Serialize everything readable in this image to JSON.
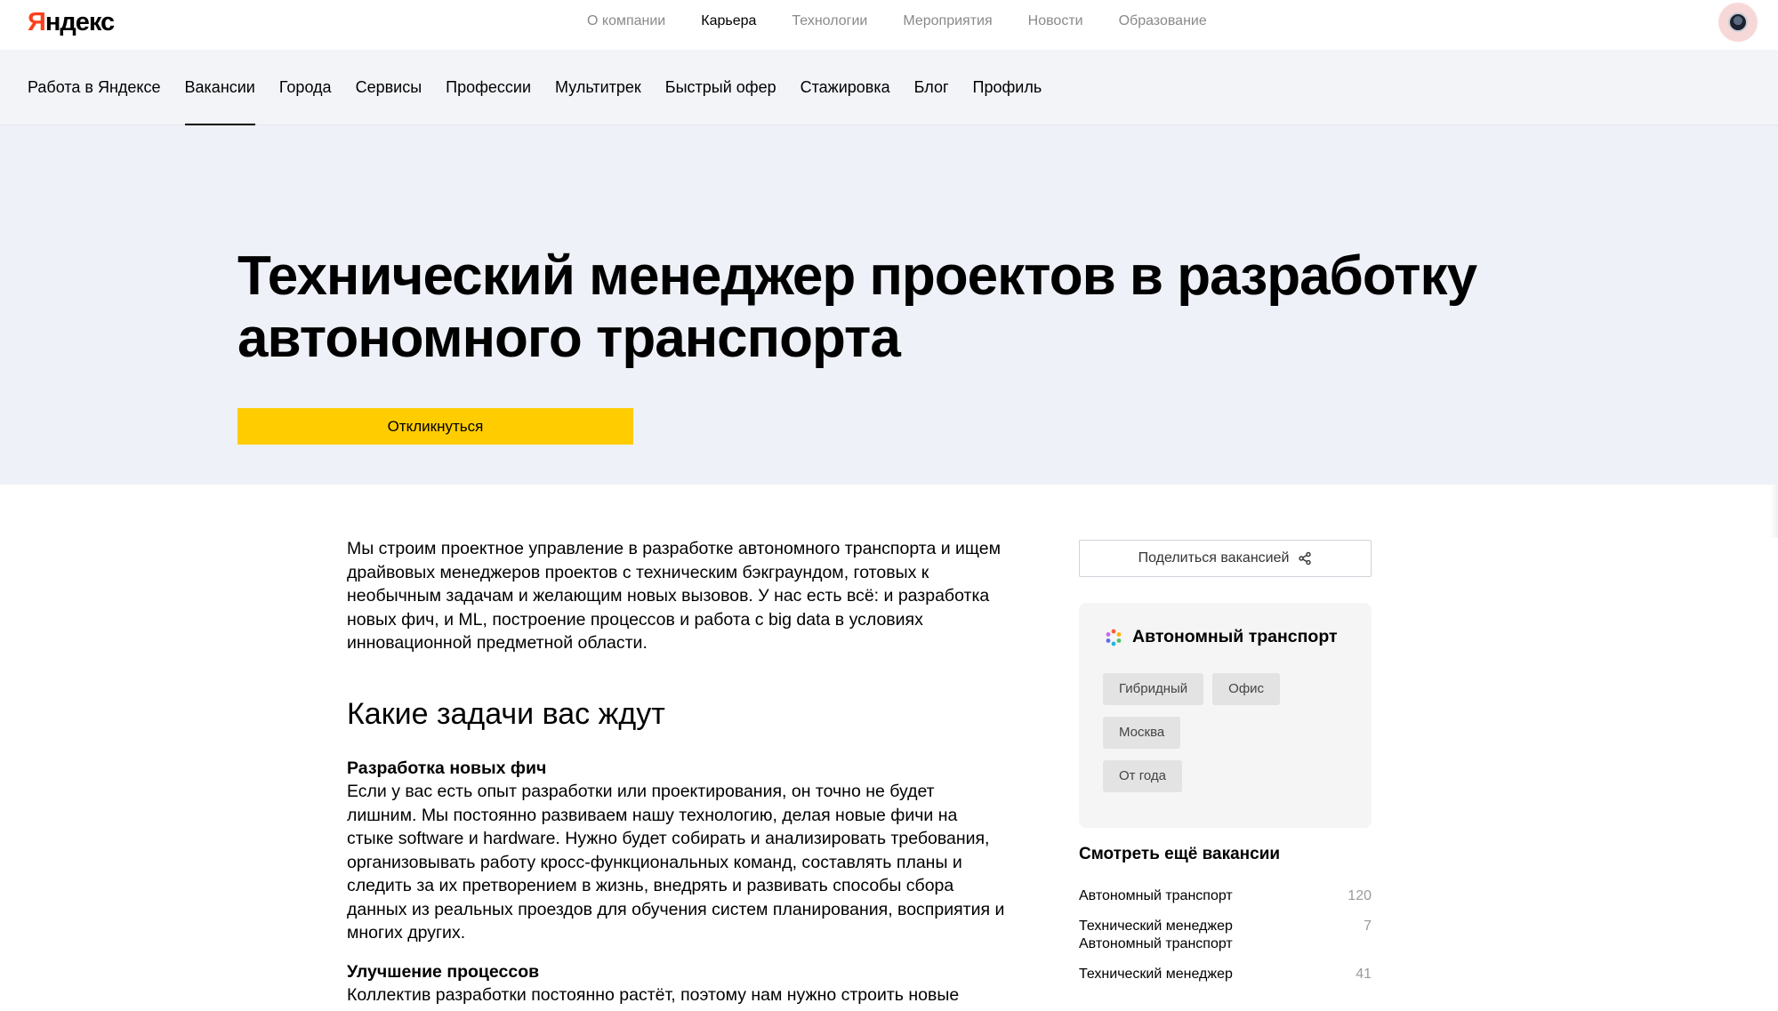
{
  "brand": {
    "logo_first": "Я",
    "logo_rest": "ндекс"
  },
  "topnav": {
    "items": [
      {
        "label": "О компании",
        "active": false
      },
      {
        "label": "Карьера",
        "active": true
      },
      {
        "label": "Технологии",
        "active": false
      },
      {
        "label": "Мероприятия",
        "active": false
      },
      {
        "label": "Новости",
        "active": false
      },
      {
        "label": "Образование",
        "active": false
      }
    ]
  },
  "subnav": {
    "items": [
      {
        "label": "Работа в Яндексе",
        "active": false
      },
      {
        "label": "Вакансии",
        "active": true
      },
      {
        "label": "Города",
        "active": false
      },
      {
        "label": "Сервисы",
        "active": false
      },
      {
        "label": "Профессии",
        "active": false
      },
      {
        "label": "Мультитрек",
        "active": false
      },
      {
        "label": "Быстрый офер",
        "active": false
      },
      {
        "label": "Стажировка",
        "active": false
      },
      {
        "label": "Блог",
        "active": false
      },
      {
        "label": "Профиль",
        "active": false
      }
    ]
  },
  "hero": {
    "title": "Технический менеджер проектов в разработку автономного транспорта",
    "apply_label": "Откликнуться"
  },
  "content": {
    "lead": "Мы строим проектное управление в разработке автономного транспорта и ищем драйвовых менеджеров проектов с техническим бэкграундом, готовых к необычным задачам и желающим новых вызовов. У нас есть всё: и разработка новых фич, и ML, построение процессов и работа с big data в условиях инновационной предметной области.",
    "section_title": "Какие задачи вас ждут",
    "tasks": [
      {
        "title": "Разработка новых фич",
        "text": "Если у вас есть опыт разработки или проектирования, он точно не будет лишним. Мы постоянно развиваем нашу технологию, делая новые фичи на стыке software и hardware. Нужно будет собирать и анализировать требования, организовывать работу кросс-функциональных команд, составлять планы и следить за их претворением в жизнь, внедрять и развивать способы сбора данных из реальных проездов для обучения систем планирования, восприятия и многих других."
      },
      {
        "title": "Улучшение процессов",
        "text": "Коллектив разработки постоянно растёт, поэтому нам нужно строить новые"
      }
    ]
  },
  "sidebar": {
    "share_label": "Поделиться вакансией",
    "service_name": "Автономный транспорт",
    "chips": [
      "Гибридный",
      "Офис",
      "Москва",
      "От года"
    ],
    "more_title": "Смотреть ещё вакансии",
    "more_items": [
      {
        "label": "Автономный транспорт",
        "count": "120"
      },
      {
        "label": "Технический менеджер Автономный транспорт",
        "count": "7"
      },
      {
        "label": "Технический менеджер",
        "count": "41"
      }
    ]
  },
  "colors": {
    "brand_red": "#fc3f1d",
    "accent_yellow": "#ffcc00",
    "hero_bg": "#eef1f7",
    "card_bg": "#f5f5f5"
  }
}
